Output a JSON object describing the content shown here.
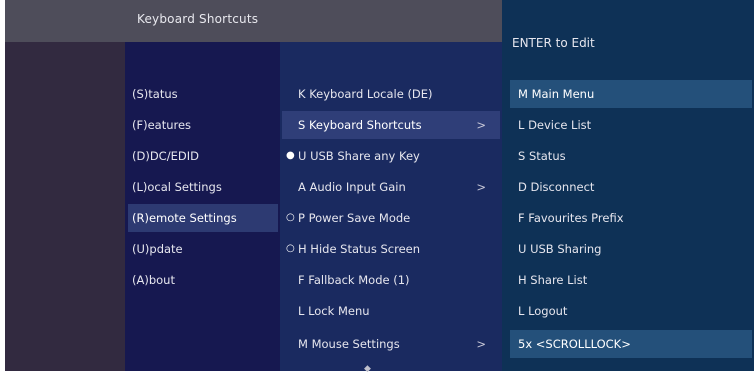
{
  "header": {
    "title": "Keyboard Shortcuts"
  },
  "hint": "ENTER to Edit",
  "categories": [
    {
      "label": "(S)tatus"
    },
    {
      "label": "(F)eatures"
    },
    {
      "label": "(D)DC/EDID"
    },
    {
      "label": "(L)ocal  Settings"
    },
    {
      "label": "(R)emote Settings",
      "selected": true
    },
    {
      "label": "(U)pdate"
    },
    {
      "label": "(A)bout"
    }
  ],
  "submenu": [
    {
      "label": "K Keyboard Locale (DE)"
    },
    {
      "label": "S Keyboard Shortcuts",
      "arrow": ">",
      "selected": true
    },
    {
      "label": "U USB Share any Key",
      "bullet": "●"
    },
    {
      "label": "A Audio Input Gain",
      "arrow": ">"
    },
    {
      "label": "P Power Save Mode",
      "bullet": "○"
    },
    {
      "label": "H Hide Status Screen",
      "bullet": "○"
    },
    {
      "label": "F Fallback Mode (1)"
    },
    {
      "label": "L Lock Menu"
    },
    {
      "label": "M Mouse Settings",
      "arrow": ">"
    }
  ],
  "shortcuts": [
    {
      "label": "M Main Menu",
      "selected": true
    },
    {
      "label": "L Device List"
    },
    {
      "label": "S Status"
    },
    {
      "label": "D Disconnect"
    },
    {
      "label": "F Favourites Prefix"
    },
    {
      "label": "U USB Sharing"
    },
    {
      "label": "H Share List"
    },
    {
      "label": "L Logout"
    },
    {
      "label": "5x <SCROLLLOCK>",
      "selected": true
    }
  ],
  "scroll_indicator": "◆",
  "colors": {
    "left_panel": "#322a40",
    "category_panel": "#161850",
    "submenu_panel": "#1a2a60",
    "right_panel": "#0e3156",
    "header_bar": "#4e4d5a",
    "selected_highlight": "#2f3e78"
  }
}
